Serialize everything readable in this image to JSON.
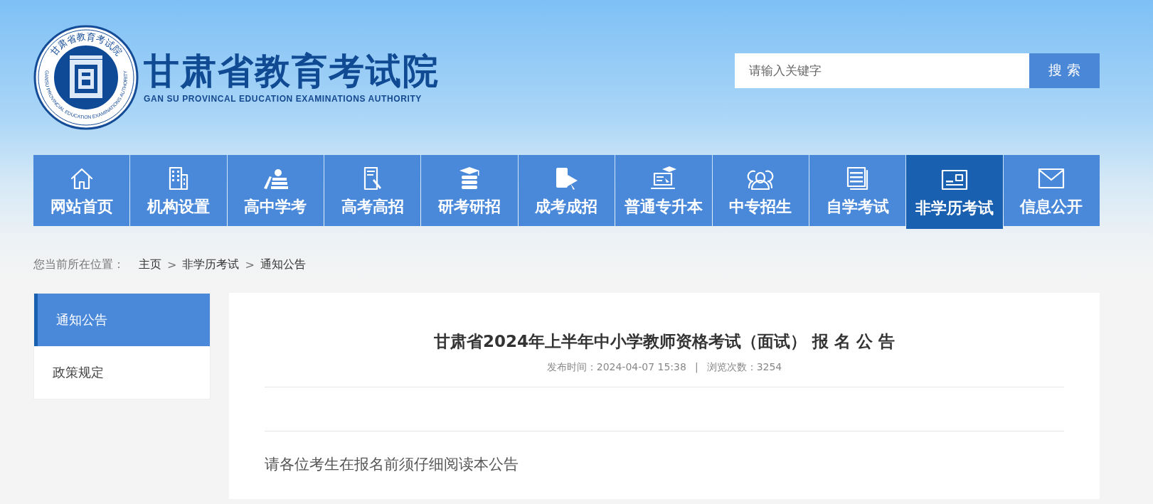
{
  "logo": {
    "ring_text": "甘肃省教育考试院",
    "ring_text_en": "GANSU PROVINCIAL EDUCATION EXAMINATIONS AUTHORITY",
    "title": "甘肃省教育考试院",
    "subtitle": "GAN SU PROVINCAL EDUCATION EXAMINATIONS AUTHORITY"
  },
  "search": {
    "placeholder": "请输入关键字",
    "button": "搜 索"
  },
  "nav": [
    {
      "label": "网站首页",
      "selected": false
    },
    {
      "label": "机构设置",
      "selected": false
    },
    {
      "label": "高中学考",
      "selected": false
    },
    {
      "label": "高考高招",
      "selected": false
    },
    {
      "label": "研考研招",
      "selected": false
    },
    {
      "label": "成考成招",
      "selected": false
    },
    {
      "label": "普通专升本",
      "selected": false
    },
    {
      "label": "中专招生",
      "selected": false
    },
    {
      "label": "自学考试",
      "selected": false
    },
    {
      "label": "非学历考试",
      "selected": true
    },
    {
      "label": "信息公开",
      "selected": false
    }
  ],
  "breadcrumb": {
    "prefix": "您当前所在位置：",
    "items": [
      "主页",
      ">",
      "非学历考试",
      ">",
      "通知公告"
    ]
  },
  "sidebar": {
    "items": [
      {
        "label": "通知公告",
        "selected": true
      },
      {
        "label": "政策规定",
        "selected": false
      }
    ]
  },
  "article": {
    "title": "甘肃省2024年上半年中小学教师资格考试（面试） 报 名 公 告",
    "published": "发布时间：2024-04-07 15:38",
    "separator": "|",
    "views": "浏览次数：3254",
    "intro": "请各位考生在报名前须仔细阅读本公告"
  }
}
